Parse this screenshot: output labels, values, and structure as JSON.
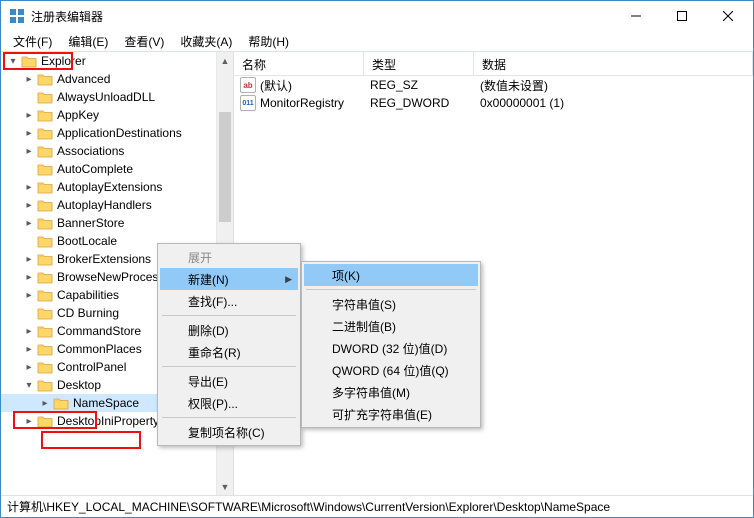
{
  "window": {
    "title": "注册表编辑器"
  },
  "menubar": {
    "items": [
      "文件(F)",
      "编辑(E)",
      "查看(V)",
      "收藏夹(A)",
      "帮助(H)"
    ]
  },
  "tree": {
    "items": [
      {
        "ind": 0,
        "exp": "▾",
        "label": "Explorer"
      },
      {
        "ind": 1,
        "exp": "▸",
        "label": "Advanced"
      },
      {
        "ind": 1,
        "exp": "",
        "label": "AlwaysUnloadDLL"
      },
      {
        "ind": 1,
        "exp": "▸",
        "label": "AppKey"
      },
      {
        "ind": 1,
        "exp": "▸",
        "label": "ApplicationDestinations"
      },
      {
        "ind": 1,
        "exp": "▸",
        "label": "Associations"
      },
      {
        "ind": 1,
        "exp": "",
        "label": "AutoComplete"
      },
      {
        "ind": 1,
        "exp": "▸",
        "label": "AutoplayExtensions"
      },
      {
        "ind": 1,
        "exp": "▸",
        "label": "AutoplayHandlers"
      },
      {
        "ind": 1,
        "exp": "▸",
        "label": "BannerStore"
      },
      {
        "ind": 1,
        "exp": "",
        "label": "BootLocale"
      },
      {
        "ind": 1,
        "exp": "▸",
        "label": "BrokerExtensions"
      },
      {
        "ind": 1,
        "exp": "▸",
        "label": "BrowseNewProcess"
      },
      {
        "ind": 1,
        "exp": "▸",
        "label": "Capabilities"
      },
      {
        "ind": 1,
        "exp": "",
        "label": "CD Burning"
      },
      {
        "ind": 1,
        "exp": "▸",
        "label": "CommandStore"
      },
      {
        "ind": 1,
        "exp": "▸",
        "label": "CommonPlaces"
      },
      {
        "ind": 1,
        "exp": "▸",
        "label": "ControlPanel"
      },
      {
        "ind": 1,
        "exp": "▾",
        "label": "Desktop"
      },
      {
        "ind": 2,
        "exp": "▸",
        "label": "NameSpace",
        "selected": true
      },
      {
        "ind": 1,
        "exp": "▸",
        "label": "DesktopIniPropertyMap"
      }
    ]
  },
  "list": {
    "columns": {
      "c0": "名称",
      "c1": "类型",
      "c2": "数据"
    },
    "rows": [
      {
        "icon": "ab",
        "name": "(默认)",
        "type": "REG_SZ",
        "data": "(数值未设置)"
      },
      {
        "icon": "dw",
        "name": "MonitorRegistry",
        "type": "REG_DWORD",
        "data": "0x00000001 (1)"
      }
    ]
  },
  "context_menu_1": {
    "items": {
      "i0": "展开",
      "i1": "新建(N)",
      "i2": "查找(F)...",
      "i3": "删除(D)",
      "i4": "重命名(R)",
      "i5": "导出(E)",
      "i6": "权限(P)...",
      "i7": "复制项名称(C)"
    }
  },
  "context_menu_2": {
    "items": {
      "i0": "项(K)",
      "i1": "字符串值(S)",
      "i2": "二进制值(B)",
      "i3": "DWORD (32 位)值(D)",
      "i4": "QWORD (64 位)值(Q)",
      "i5": "多字符串值(M)",
      "i6": "可扩充字符串值(E)"
    }
  },
  "statusbar": {
    "path": "计算机\\HKEY_LOCAL_MACHINE\\SOFTWARE\\Microsoft\\Windows\\CurrentVersion\\Explorer\\Desktop\\NameSpace"
  }
}
